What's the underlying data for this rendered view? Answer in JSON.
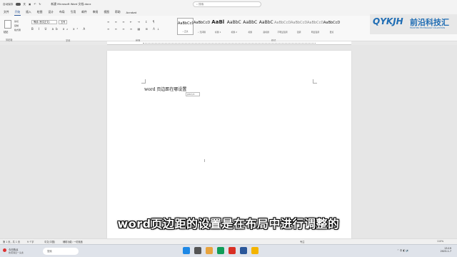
{
  "titlebar": {
    "autosave_label": "自动保存",
    "autosave_state": "关",
    "save_icon": "save-icon",
    "undo_icon": "undo-icon",
    "redo_icon": "redo-icon",
    "doc_title": "新建 Microsoft Word 文档.docx",
    "search_placeholder": "搜索"
  },
  "menu": [
    "文件",
    "开始",
    "插入",
    "绘图",
    "设计",
    "布局",
    "引用",
    "邮件",
    "审阅",
    "视图",
    "帮助",
    "Acrobat"
  ],
  "menu_active_index": 1,
  "ribbon": {
    "paste_label": "粘贴",
    "cut_label": "剪切",
    "copy_label": "复制",
    "format_painter_label": "格式刷",
    "clipboard_group": "剪贴板",
    "font_name": "等线 (西文正文)",
    "font_size": "五号",
    "format_buttons": "B I U ab x₂ x² A",
    "font_group": "字体",
    "para_row1": "≡ ≡ ≡ ⇤ ⇥ ↕ ¶",
    "para_row2": "≡ ≡ ≡ ≡ ▦ ⊞ A↓",
    "paragraph_group": "段落",
    "styles_group": "样式",
    "styles": [
      {
        "sample": "AaBbCcDd",
        "name": "• 正文",
        "size": "small",
        "selected": true
      },
      {
        "sample": "AaBbCcDd",
        "name": "• 无间隔",
        "size": "small"
      },
      {
        "sample": "AaBl",
        "name": "标题 1",
        "size": "big"
      },
      {
        "sample": "AaBbC",
        "name": "标题 2",
        "size": "med"
      },
      {
        "sample": "AaBbC",
        "name": "标题",
        "size": "med"
      },
      {
        "sample": "AaBbC",
        "name": "副标题",
        "size": "med"
      },
      {
        "sample": "AaBbCcDd",
        "name": "不明显强调",
        "size": "small",
        "grey": true
      },
      {
        "sample": "AaBbCcDd",
        "name": "强调",
        "size": "small",
        "grey": true
      },
      {
        "sample": "AaBbCcDd",
        "name": "明显强调",
        "size": "small",
        "grey": true
      },
      {
        "sample": "AaBbCcDd",
        "name": "要点",
        "size": "small"
      }
    ]
  },
  "logo": {
    "mark": "QYKJH",
    "chinese": "前沿科技汇",
    "english": "FRONTIER TECHNOLOGY COLLECTION"
  },
  "document": {
    "body_text": "word 页边距在哪设置",
    "paste_options": "(Ctrl) ▾",
    "cursor": "I"
  },
  "subtitle": "word页边距的设置是在布局中进行调整的",
  "status": {
    "page": "第 1 页，共 1 页",
    "words": "9 个字",
    "lang": "中文(中国)",
    "accessibility": "辅助功能: 一切就绪",
    "focus": "专注",
    "zoom": "110%"
  },
  "taskbar": {
    "weather_title": "今日热点",
    "weather_sub": "新闻消息一头条",
    "search_placeholder": "搜索",
    "tray": "⌃ 中 ◧ 🔊",
    "time": "13:19",
    "date": "2023-1-7"
  },
  "colors": {
    "accent": "#2b579a",
    "logo": "#1f6db4"
  }
}
